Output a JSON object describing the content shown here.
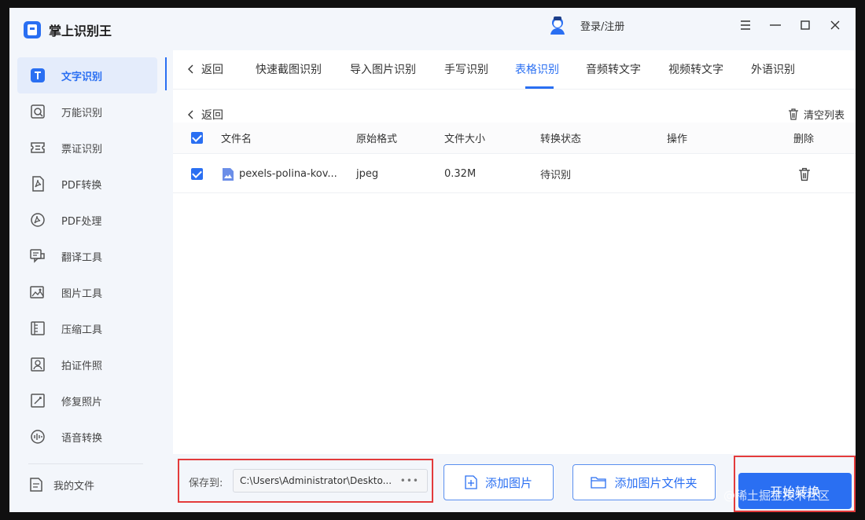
{
  "app": {
    "title": "掌上识别王"
  },
  "sidebar": {
    "items": [
      {
        "label": "文字识别",
        "icon": "text-recognition-icon",
        "active": true
      },
      {
        "label": "万能识别",
        "icon": "universal-scan-icon",
        "active": false
      },
      {
        "label": "票证识别",
        "icon": "ticket-icon",
        "active": false
      },
      {
        "label": "PDF转换",
        "icon": "pdf-convert-icon",
        "active": false
      },
      {
        "label": "PDF处理",
        "icon": "pdf-process-icon",
        "active": false
      },
      {
        "label": "翻译工具",
        "icon": "translate-icon",
        "active": false
      },
      {
        "label": "图片工具",
        "icon": "image-tool-icon",
        "active": false
      },
      {
        "label": "压缩工具",
        "icon": "compress-icon",
        "active": false
      },
      {
        "label": "拍证件照",
        "icon": "id-photo-icon",
        "active": false
      },
      {
        "label": "修复照片",
        "icon": "repair-photo-icon",
        "active": false
      },
      {
        "label": "语音转换",
        "icon": "voice-convert-icon",
        "active": false
      }
    ],
    "my_files": "我的文件"
  },
  "header": {
    "login": "登录/注册"
  },
  "tabs": {
    "back": "返回",
    "items": [
      "快速截图识别",
      "导入图片识别",
      "手写识别",
      "表格识别",
      "音频转文字",
      "视频转文字",
      "外语识别"
    ],
    "active": "表格识别"
  },
  "list": {
    "back": "返回",
    "clear": "清空列表",
    "columns": {
      "name": "文件名",
      "format": "原始格式",
      "size": "文件大小",
      "status": "转换状态",
      "action": "操作",
      "delete": "删除"
    },
    "rows": [
      {
        "name": "pexels-polina-kov...",
        "format": "jpeg",
        "size": "0.32M",
        "status": "待识别",
        "checked": true
      }
    ]
  },
  "bottom": {
    "save_label": "保存到:",
    "save_path": "C:\\Users\\Administrator\\Deskto...",
    "add_image": "添加图片",
    "add_folder": "添加图片文件夹",
    "start": "开始转换"
  },
  "watermark": "@稀土掘金技术社区",
  "colors": {
    "accent": "#2a6ff2",
    "highlight": "#e33b3b"
  }
}
